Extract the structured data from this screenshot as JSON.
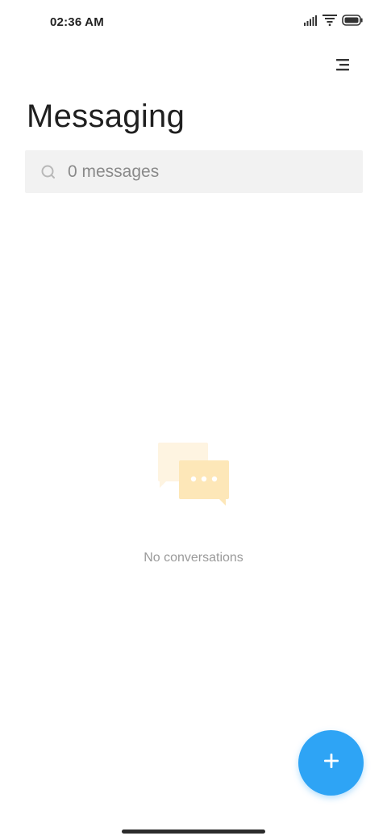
{
  "status_bar": {
    "time": "02:36 AM",
    "icons": [
      "signal-icon",
      "wifi-icon",
      "battery-icon"
    ]
  },
  "header": {
    "menu_icon": "menu-icon",
    "title": "Messaging"
  },
  "search": {
    "placeholder": "0 messages",
    "icon": "search-icon"
  },
  "empty_state": {
    "illustration": "chat-bubbles-icon",
    "text": "No conversations"
  },
  "fab": {
    "icon": "plus-icon",
    "color": "#2ea4f5"
  },
  "colors": {
    "accent": "#2ea4f5",
    "illustration_primary": "#fde7b8",
    "illustration_secondary": "#fef4e1"
  }
}
